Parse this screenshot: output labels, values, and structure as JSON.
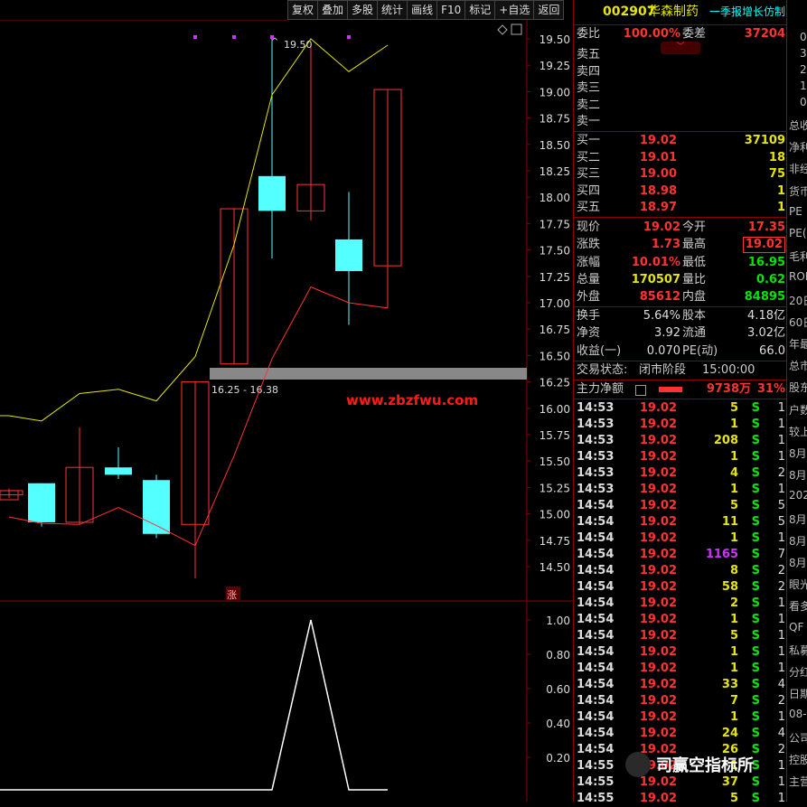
{
  "toolbar": [
    "复权",
    "叠加",
    "多股",
    "统计",
    "画线",
    "F10",
    "标记",
    "+自选",
    "返回"
  ],
  "stock": {
    "code": "002907",
    "name": "华森制药",
    "tag": "一季报增长仿制"
  },
  "weibi": {
    "label": "委比",
    "value": "100.00%",
    "label2": "委差",
    "value2": "37204"
  },
  "sells": [
    "卖五",
    "卖四",
    "卖三",
    "卖二",
    "卖一"
  ],
  "buys": [
    {
      "label": "买一",
      "price": "19.02",
      "vol": "37109"
    },
    {
      "label": "买二",
      "price": "19.01",
      "vol": "18"
    },
    {
      "label": "买三",
      "price": "19.00",
      "vol": "75"
    },
    {
      "label": "买四",
      "price": "18.98",
      "vol": "1"
    },
    {
      "label": "买五",
      "price": "18.97",
      "vol": "1"
    }
  ],
  "quote": [
    {
      "l1": "现价",
      "v1": "19.02",
      "c1": "red",
      "l2": "今开",
      "v2": "17.35",
      "c2": "red"
    },
    {
      "l1": "涨跌",
      "v1": "1.73",
      "c1": "red",
      "l2": "最高",
      "v2": "19.02",
      "c2": "red"
    },
    {
      "l1": "涨幅",
      "v1": "10.01%",
      "c1": "red",
      "l2": "最低",
      "v2": "16.95",
      "c2": "grn"
    },
    {
      "l1": "总量",
      "v1": "170507",
      "c1": "yel",
      "l2": "量比",
      "v2": "0.62",
      "c2": "grn"
    },
    {
      "l1": "外盘",
      "v1": "85612",
      "c1": "red",
      "l2": "内盘",
      "v2": "84895",
      "c2": "grn"
    }
  ],
  "fund": [
    {
      "l1": "换手",
      "v1": "5.64%",
      "l2": "股本",
      "v2": "4.18亿"
    },
    {
      "l1": "净资",
      "v1": "3.92",
      "l2": "流通",
      "v2": "3.02亿"
    },
    {
      "l1": "收益(一)",
      "v1": "0.070",
      "l2": "PE(动)",
      "v2": "66.0"
    }
  ],
  "status": {
    "label": "交易状态:",
    "state": "闭市阶段",
    "time": "15:00:00"
  },
  "main_net": {
    "label": "主力净额",
    "value": "9738万",
    "pct": "31%"
  },
  "ticks": [
    {
      "t": "14:53",
      "p": "19.02",
      "v": "5",
      "vc": "yel",
      "s": "S",
      "n": "1"
    },
    {
      "t": "14:53",
      "p": "19.02",
      "v": "1",
      "vc": "yel",
      "s": "S",
      "n": "1"
    },
    {
      "t": "14:53",
      "p": "19.02",
      "v": "208",
      "vc": "yel",
      "s": "S",
      "n": "1"
    },
    {
      "t": "14:53",
      "p": "19.02",
      "v": "1",
      "vc": "yel",
      "s": "S",
      "n": "1"
    },
    {
      "t": "14:53",
      "p": "19.02",
      "v": "4",
      "vc": "yel",
      "s": "S",
      "n": "2"
    },
    {
      "t": "14:53",
      "p": "19.02",
      "v": "1",
      "vc": "yel",
      "s": "S",
      "n": "1"
    },
    {
      "t": "14:54",
      "p": "19.02",
      "v": "5",
      "vc": "yel",
      "s": "S",
      "n": "5"
    },
    {
      "t": "14:54",
      "p": "19.02",
      "v": "11",
      "vc": "yel",
      "s": "S",
      "n": "5"
    },
    {
      "t": "14:54",
      "p": "19.02",
      "v": "1",
      "vc": "yel",
      "s": "S",
      "n": "1"
    },
    {
      "t": "14:54",
      "p": "19.02",
      "v": "1165",
      "vc": "pur",
      "s": "S",
      "n": "7"
    },
    {
      "t": "14:54",
      "p": "19.02",
      "v": "8",
      "vc": "yel",
      "s": "S",
      "n": "2"
    },
    {
      "t": "14:54",
      "p": "19.02",
      "v": "58",
      "vc": "yel",
      "s": "S",
      "n": "2"
    },
    {
      "t": "14:54",
      "p": "19.02",
      "v": "2",
      "vc": "yel",
      "s": "S",
      "n": "1"
    },
    {
      "t": "14:54",
      "p": "19.02",
      "v": "1",
      "vc": "yel",
      "s": "S",
      "n": "1"
    },
    {
      "t": "14:54",
      "p": "19.02",
      "v": "5",
      "vc": "yel",
      "s": "S",
      "n": "1"
    },
    {
      "t": "14:54",
      "p": "19.02",
      "v": "1",
      "vc": "yel",
      "s": "S",
      "n": "1"
    },
    {
      "t": "14:54",
      "p": "19.02",
      "v": "1",
      "vc": "yel",
      "s": "S",
      "n": "1"
    },
    {
      "t": "14:54",
      "p": "19.02",
      "v": "33",
      "vc": "yel",
      "s": "S",
      "n": "4"
    },
    {
      "t": "14:54",
      "p": "19.02",
      "v": "7",
      "vc": "yel",
      "s": "S",
      "n": "2"
    },
    {
      "t": "14:54",
      "p": "19.02",
      "v": "1",
      "vc": "yel",
      "s": "S",
      "n": "1"
    },
    {
      "t": "14:54",
      "p": "19.02",
      "v": "24",
      "vc": "yel",
      "s": "S",
      "n": "4"
    },
    {
      "t": "14:54",
      "p": "19.02",
      "v": "26",
      "vc": "yel",
      "s": "S",
      "n": "2"
    },
    {
      "t": "14:55",
      "p": "19.02",
      "v": "1",
      "vc": "yel",
      "s": "S",
      "n": "1"
    },
    {
      "t": "14:55",
      "p": "19.02",
      "v": "37",
      "vc": "yel",
      "s": "S",
      "n": "1"
    },
    {
      "t": "14:55",
      "p": "19.02",
      "v": "5",
      "vc": "yel",
      "s": "S",
      "n": "1"
    }
  ],
  "sidebar": [
    "总收",
    "净利",
    "非经",
    "货币",
    "PE",
    "PE(",
    "毛利",
    "ROE",
    "20日",
    "60日",
    "年最",
    "总市",
    "股东",
    "户数",
    "较上",
    "8月",
    "8月",
    "202",
    "8月",
    "8月",
    "8月",
    "眼光",
    "看多",
    "QF",
    "私募",
    "分红",
    "日期",
    "08-",
    "公司",
    "控股",
    "主营"
  ],
  "sidebar_top": [
    "0",
    "3",
    "2",
    "1",
    "0"
  ],
  "chart": {
    "price_ticks": [
      "19.50",
      "19.25",
      "19.00",
      "18.75",
      "18.50",
      "18.25",
      "18.00",
      "17.75",
      "17.50",
      "17.25",
      "17.00",
      "16.75",
      "16.50",
      "16.25",
      "16.00",
      "15.75",
      "15.50",
      "15.25",
      "15.00",
      "14.75",
      "14.50"
    ],
    "ind_ticks": [
      "1.00",
      "0.80",
      "0.60",
      "0.40",
      "0.20"
    ],
    "hi_label": "19.50",
    "gap_label": "16.25 - 16.38",
    "watermark": "www.zbzfwu.com",
    "zhang": "涨",
    "brand": "司赢空指标所"
  },
  "chart_data": {
    "type": "candlestick",
    "candles": [
      {
        "o": 15.22,
        "c": 15.18,
        "h": 15.24,
        "l": 15.15,
        "up": true
      },
      {
        "o": 15.29,
        "c": 14.92,
        "h": 15.29,
        "l": 14.88,
        "up": false
      },
      {
        "o": 14.92,
        "c": 15.44,
        "h": 15.82,
        "l": 14.9,
        "up": true
      },
      {
        "o": 15.44,
        "c": 15.37,
        "h": 15.63,
        "l": 15.33,
        "up": false
      },
      {
        "o": 15.32,
        "c": 14.81,
        "h": 15.37,
        "l": 14.77,
        "up": false
      },
      {
        "o": 14.9,
        "c": 16.25,
        "h": 16.25,
        "l": 14.39,
        "up": true
      },
      {
        "o": 16.42,
        "c": 17.89,
        "h": 17.89,
        "l": 16.42,
        "up": true
      },
      {
        "o": 18.2,
        "c": 17.87,
        "h": 19.5,
        "l": 17.42,
        "up": false
      },
      {
        "o": 17.87,
        "c": 18.12,
        "h": 19.43,
        "l": 17.78,
        "up": true
      },
      {
        "o": 17.6,
        "c": 17.3,
        "h": 18.05,
        "l": 16.79,
        "up": false
      },
      {
        "o": 17.35,
        "c": 19.02,
        "h": 19.02,
        "l": 16.95,
        "up": true
      }
    ],
    "yellow_line": [
      15.93,
      15.88,
      16.14,
      16.18,
      16.07,
      16.49,
      17.55,
      18.97,
      19.5,
      19.19,
      19.44
    ],
    "red_line": [
      14.97,
      14.91,
      14.9,
      15.06,
      14.89,
      14.7,
      15.55,
      16.47,
      17.15,
      17.0,
      16.95
    ],
    "indicator": [
      0,
      0,
      0,
      0,
      0,
      0,
      0,
      0,
      1.0,
      0,
      0
    ],
    "ylim": [
      14.3,
      19.65
    ]
  },
  "colors": {
    "up": "#ff3232",
    "down": "#54ffff",
    "yellow": "#e6e600",
    "grid": "#8b0000"
  }
}
